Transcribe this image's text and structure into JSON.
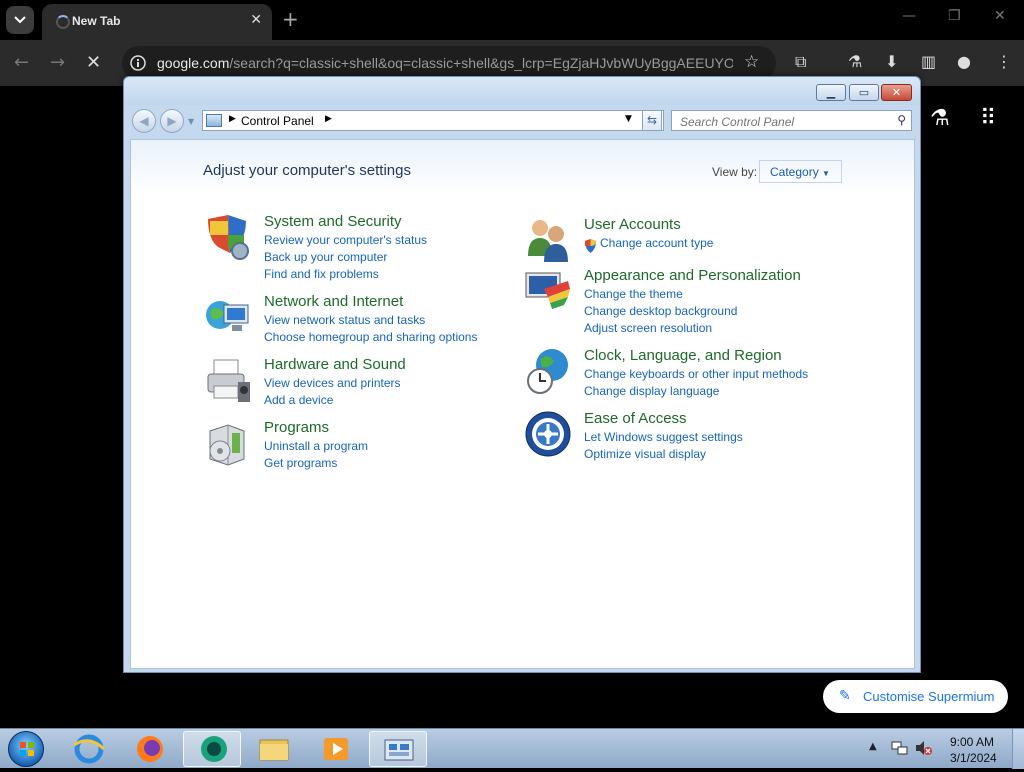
{
  "browser": {
    "tab_title": "New Tab",
    "tab_close": "✕",
    "new_tab": "+",
    "url_host": "google.com",
    "url_rest": "/search?q=classic+shell&oq=classic+shell&gs_lcrp=EgZjaHJvbWUyBggAEEUYO..."
  },
  "control_panel": {
    "address_path": "Control Panel",
    "search_placeholder": "Search Control Panel",
    "heading": "Adjust your computer's settings",
    "view_by_label": "View by:",
    "view_by_value": "Category",
    "categories": [
      {
        "title": "System and Security",
        "links": [
          "Review your computer's status",
          "Back up your computer",
          "Find and fix problems"
        ]
      },
      {
        "title": "Network and Internet",
        "links": [
          "View network status and tasks",
          "Choose homegroup and sharing options"
        ]
      },
      {
        "title": "Hardware and Sound",
        "links": [
          "View devices and printers",
          "Add a device"
        ]
      },
      {
        "title": "Programs",
        "links": [
          "Uninstall a program",
          "Get programs"
        ]
      },
      {
        "title": "User Accounts",
        "links": [
          "Change account type"
        ]
      },
      {
        "title": "Appearance and Personalization",
        "links": [
          "Change the theme",
          "Change desktop background",
          "Adjust screen resolution"
        ]
      },
      {
        "title": "Clock, Language, and Region",
        "links": [
          "Change keyboards or other input methods",
          "Change display language"
        ]
      },
      {
        "title": "Ease of Access",
        "links": [
          "Let Windows suggest settings",
          "Optimize visual display"
        ]
      }
    ]
  },
  "customise_label": "Customise Supermium",
  "taskbar": {
    "time": "9:00 AM",
    "date": "3/1/2024"
  },
  "colors": {
    "link": "#1565b8",
    "category_title": "#1e6a2a",
    "heading": "#1e395b"
  }
}
